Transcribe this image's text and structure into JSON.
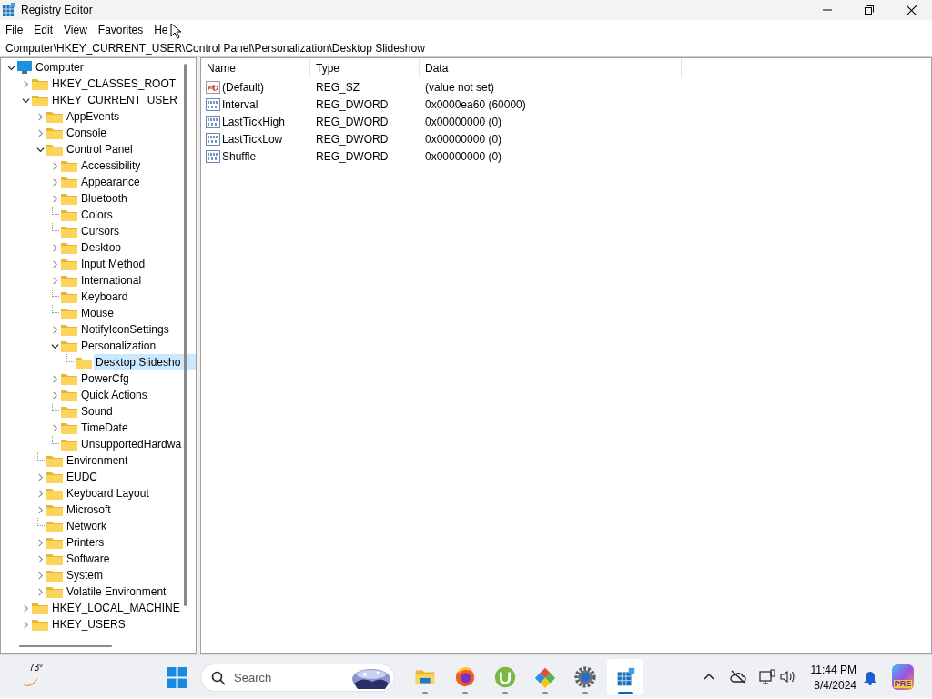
{
  "window": {
    "title": "Registry Editor"
  },
  "menu": [
    "File",
    "Edit",
    "View",
    "Favorites",
    "He"
  ],
  "address": "Computer\\HKEY_CURRENT_USER\\Control Panel\\Personalization\\Desktop Slideshow",
  "tree": [
    {
      "label": "Computer",
      "kind": "computer",
      "expandable": true,
      "expanded": true,
      "selected": false,
      "children": [
        {
          "label": "HKEY_CLASSES_ROOT",
          "expandable": true,
          "expanded": false,
          "selected": false
        },
        {
          "label": "HKEY_CURRENT_USER",
          "expandable": true,
          "expanded": true,
          "selected": false,
          "children": [
            {
              "label": "AppEvents",
              "expandable": true,
              "expanded": false,
              "selected": false
            },
            {
              "label": "Console",
              "expandable": true,
              "expanded": false,
              "selected": false
            },
            {
              "label": "Control Panel",
              "expandable": true,
              "expanded": true,
              "selected": false,
              "children": [
                {
                  "label": "Accessibility",
                  "expandable": true,
                  "expanded": false,
                  "selected": false
                },
                {
                  "label": "Appearance",
                  "expandable": true,
                  "expanded": false,
                  "selected": false
                },
                {
                  "label": "Bluetooth",
                  "expandable": true,
                  "expanded": false,
                  "selected": false
                },
                {
                  "label": "Colors",
                  "expandable": false,
                  "selected": false
                },
                {
                  "label": "Cursors",
                  "expandable": false,
                  "selected": false
                },
                {
                  "label": "Desktop",
                  "expandable": true,
                  "expanded": false,
                  "selected": false
                },
                {
                  "label": "Input Method",
                  "expandable": true,
                  "expanded": false,
                  "selected": false
                },
                {
                  "label": "International",
                  "expandable": true,
                  "expanded": false,
                  "selected": false
                },
                {
                  "label": "Keyboard",
                  "expandable": false,
                  "selected": false
                },
                {
                  "label": "Mouse",
                  "expandable": false,
                  "selected": false
                },
                {
                  "label": "NotifyIconSettings",
                  "expandable": true,
                  "expanded": false,
                  "selected": false
                },
                {
                  "label": "Personalization",
                  "expandable": true,
                  "expanded": true,
                  "selected": false,
                  "children": [
                    {
                      "label": "Desktop Slidesho",
                      "expandable": false,
                      "selected": true
                    }
                  ]
                },
                {
                  "label": "PowerCfg",
                  "expandable": true,
                  "expanded": false,
                  "selected": false
                },
                {
                  "label": "Quick Actions",
                  "expandable": true,
                  "expanded": false,
                  "selected": false
                },
                {
                  "label": "Sound",
                  "expandable": false,
                  "selected": false
                },
                {
                  "label": "TimeDate",
                  "expandable": true,
                  "expanded": false,
                  "selected": false
                },
                {
                  "label": "UnsupportedHardwa",
                  "expandable": false,
                  "selected": false
                }
              ]
            },
            {
              "label": "Environment",
              "expandable": false,
              "selected": false
            },
            {
              "label": "EUDC",
              "expandable": true,
              "expanded": false,
              "selected": false
            },
            {
              "label": "Keyboard Layout",
              "expandable": true,
              "expanded": false,
              "selected": false
            },
            {
              "label": "Microsoft",
              "expandable": true,
              "expanded": false,
              "selected": false
            },
            {
              "label": "Network",
              "expandable": false,
              "selected": false
            },
            {
              "label": "Printers",
              "expandable": true,
              "expanded": false,
              "selected": false
            },
            {
              "label": "Software",
              "expandable": true,
              "expanded": false,
              "selected": false
            },
            {
              "label": "System",
              "expandable": true,
              "expanded": false,
              "selected": false
            },
            {
              "label": "Volatile Environment",
              "expandable": true,
              "expanded": false,
              "selected": false
            }
          ]
        },
        {
          "label": "HKEY_LOCAL_MACHINE",
          "expandable": true,
          "expanded": false,
          "selected": false
        },
        {
          "label": "HKEY_USERS",
          "expandable": true,
          "expanded": false,
          "selected": false
        }
      ]
    }
  ],
  "table": {
    "columns": [
      "Name",
      "Type",
      "Data"
    ],
    "rows": [
      {
        "kind": "string",
        "name": "(Default)",
        "type": "REG_SZ",
        "data": "(value not set)"
      },
      {
        "kind": "binary",
        "name": "Interval",
        "type": "REG_DWORD",
        "data": "0x0000ea60 (60000)"
      },
      {
        "kind": "binary",
        "name": "LastTickHigh",
        "type": "REG_DWORD",
        "data": "0x00000000 (0)"
      },
      {
        "kind": "binary",
        "name": "LastTickLow",
        "type": "REG_DWORD",
        "data": "0x00000000 (0)"
      },
      {
        "kind": "binary",
        "name": "Shuffle",
        "type": "REG_DWORD",
        "data": "0x00000000 (0)"
      }
    ]
  },
  "taskbar": {
    "weather": "73°",
    "search_placeholder": "Search",
    "apps": [
      {
        "kind": "folder",
        "selected": false
      },
      {
        "kind": "browser",
        "selected": false
      },
      {
        "kind": "torrent",
        "selected": false
      },
      {
        "kind": "tiles",
        "selected": false
      },
      {
        "kind": "settings",
        "selected": false
      },
      {
        "kind": "regedit",
        "selected": true
      }
    ],
    "time": "11:44 PM",
    "date": "8/4/2024",
    "copilot_badge": "PRE"
  }
}
